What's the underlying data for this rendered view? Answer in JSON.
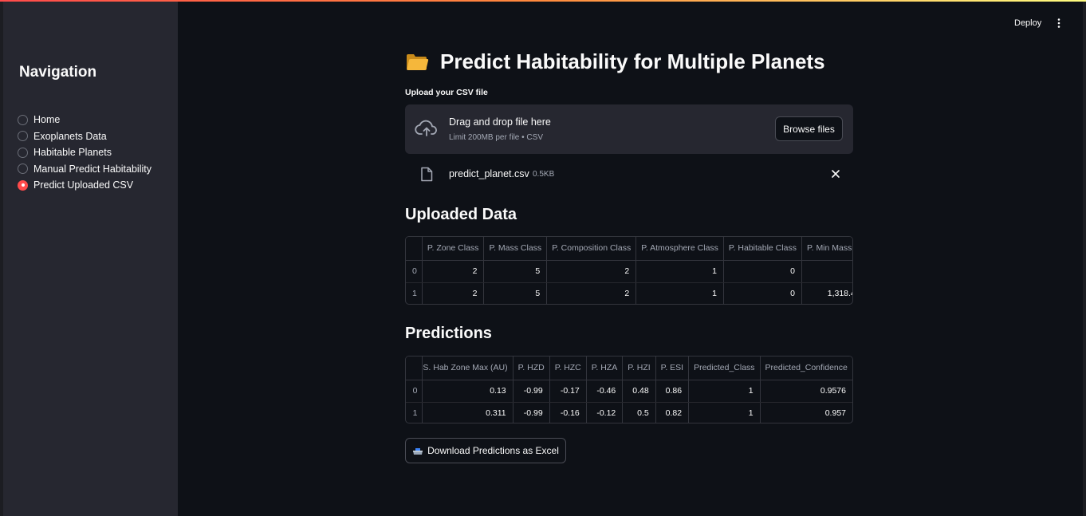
{
  "header": {
    "deploy_label": "Deploy",
    "menu_icon": "kebab-menu-icon"
  },
  "sidebar": {
    "title": "Navigation",
    "items": [
      {
        "label": "Home",
        "selected": false
      },
      {
        "label": "Exoplanets Data",
        "selected": false
      },
      {
        "label": "Habitable Planets",
        "selected": false
      },
      {
        "label": "Manual Predict Habitability",
        "selected": false
      },
      {
        "label": "Predict Uploaded CSV",
        "selected": true
      }
    ]
  },
  "main": {
    "title": "Predict Habitability for Multiple Planets",
    "title_icon": "folder-icon",
    "upload": {
      "label": "Upload your CSV file",
      "drop_title": "Drag and drop file here",
      "drop_subtitle": "Limit 200MB per file • CSV",
      "browse_label": "Browse files"
    },
    "file": {
      "name": "predict_planet.csv",
      "size": "0.5KB"
    },
    "uploaded_heading": "Uploaded Data",
    "uploaded_table": {
      "columns": [
        "",
        "P. Zone Class",
        "P. Mass Class",
        "P. Composition Class",
        "P. Atmosphere Class",
        "P. Habitable Class",
        "P. Min Mass ("
      ],
      "rows": [
        [
          "0",
          "2",
          "5",
          "2",
          "1",
          "0",
          ""
        ],
        [
          "1",
          "2",
          "5",
          "2",
          "1",
          "0",
          "1,318.4"
        ]
      ]
    },
    "predictions_heading": "Predictions",
    "predictions_table": {
      "columns": [
        "",
        "S. Hab Zone Max (AU)",
        "P. HZD",
        "P. HZC",
        "P. HZA",
        "P. HZI",
        "P. ESI",
        "Predicted_Class",
        "Predicted_Confidence"
      ],
      "rows": [
        [
          "0",
          "0.13",
          "-0.99",
          "-0.17",
          "-0.46",
          "0.48",
          "0.86",
          "1",
          "0.9576"
        ],
        [
          "1",
          "0.311",
          "-0.99",
          "-0.16",
          "-0.12",
          "0.5",
          "0.82",
          "1",
          "0.957"
        ]
      ]
    },
    "download_label": "Download Predictions as Excel"
  }
}
